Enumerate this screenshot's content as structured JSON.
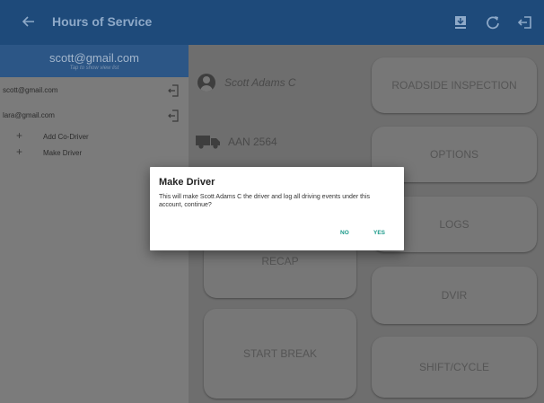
{
  "app_bar": {
    "title": "Hours of Service",
    "back_icon": "arrow-left-icon",
    "actions": [
      "download-icon",
      "refresh-icon",
      "logout-icon"
    ]
  },
  "drawer": {
    "header_email": "scott@gmail.com",
    "header_hint": "Tap to show view list",
    "accounts": [
      {
        "email": "scott@gmail.com",
        "icon": "logout-icon"
      },
      {
        "email": "lara@gmail.com",
        "icon": "logout-icon"
      }
    ],
    "actions": [
      {
        "label": "Add Co-Driver",
        "icon": "plus-icon"
      },
      {
        "label": "Make Driver",
        "icon": "plus-icon"
      }
    ]
  },
  "main": {
    "driver_name": "Scott Adams C",
    "vehicle": "AAN 2564",
    "tiles": {
      "roadside": "ROADSIDE INSPECTION",
      "options": "OPTIONS",
      "logs": "LOGS",
      "recap": "RECAP",
      "dvir": "DVIR",
      "start_break": "START BREAK",
      "shift_cycle": "SHIFT/CYCLE"
    }
  },
  "dialog": {
    "title": "Make Driver",
    "message": "This will make Scott Adams C the driver and log all driving events under this account, continue?",
    "no_label": "NO",
    "yes_label": "YES"
  },
  "colors": {
    "app_bar": "#1e4a7a",
    "drawer_header": "#2c5686",
    "dialog_accent": "#1b9a8a"
  }
}
